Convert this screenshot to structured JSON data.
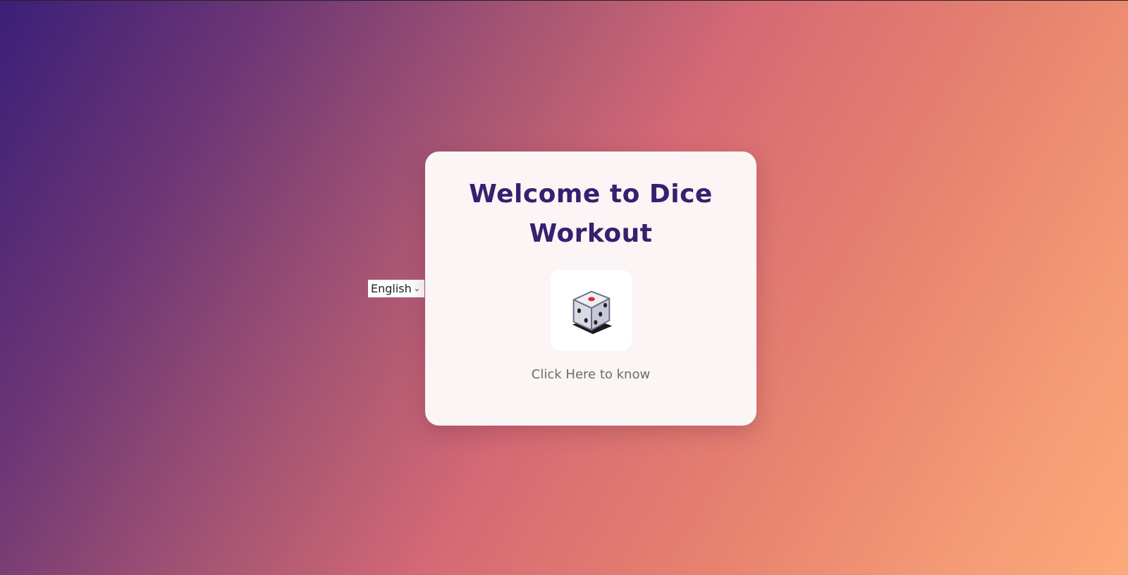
{
  "language_select": {
    "selected": "English",
    "icon": "chevron-down-icon"
  },
  "card": {
    "title": "Welcome to Dice Workout",
    "dice_icon": "dice-icon",
    "link_label": "Click Here to know"
  },
  "colors": {
    "title": "#36206f",
    "card_bg": "#fbf5f5",
    "gradient_start": "#3b1f78",
    "gradient_end": "#fca979"
  }
}
